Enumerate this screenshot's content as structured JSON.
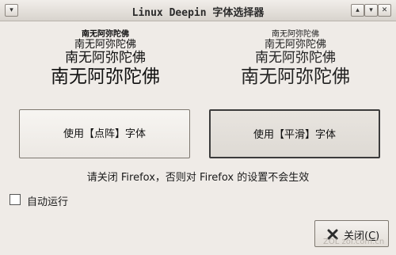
{
  "window": {
    "title": "Linux Deepin 字体选择器",
    "menu_icon": "chevron-down-icon",
    "min_icon": "minimize-icon",
    "max_icon": "maximize-icon",
    "close_icon": "close-x-icon"
  },
  "left_samples": [
    "南无阿弥陀佛",
    "南无阿弥陀佛",
    "南无阿弥陀佛",
    "南无阿弥陀佛"
  ],
  "right_samples": [
    "南无阿弥陀佛",
    "南无阿弥陀佛",
    "南无阿弥陀佛",
    "南无阿弥陀佛"
  ],
  "buttons": {
    "dot_font": "使用【点阵】字体",
    "smooth_font": "使用【平滑】字体"
  },
  "notice": "请关闭 Firefox，否则对 Firefox 的设置不会生效",
  "autorun": {
    "label": "自动运行",
    "checked": false
  },
  "close_button": {
    "label_prefix": "关闭(",
    "mnemonic": "C",
    "label_suffix": ")",
    "icon": "close-icon"
  },
  "watermark": "ZOL zol.com.cn"
}
